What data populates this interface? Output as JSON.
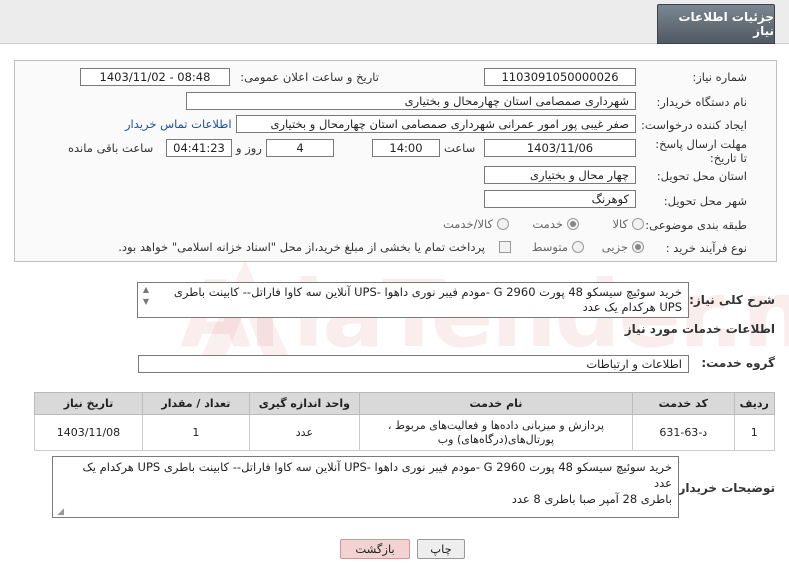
{
  "header": {
    "title": "جزئیات اطلاعات نیاز"
  },
  "form": {
    "need_number_label": "شماره نیاز:",
    "need_number": "1103091050000026",
    "announce_label": "تاریخ و ساعت اعلان عمومی:",
    "announce_value": "1403/11/02 - 08:48",
    "buyer_org_label": "نام دستگاه خریدار:",
    "buyer_org": "شهرداری صمصامی استان چهارمحال و بختیاری",
    "creator_label": "ایجاد کننده درخواست:",
    "creator": "صفر غیبی پور امور عمرانی شهرداری صمصامی استان چهارمحال و بختیاری",
    "contact_link": "اطلاعات تماس خریدار",
    "deadline_label": "مهلت ارسال پاسخ: تا تاریخ:",
    "deadline_date": "1403/11/06",
    "time_label": "ساعت",
    "deadline_time": "14:00",
    "days_value": "4",
    "days_label": "روز و",
    "remaining_time": "04:41:23",
    "remaining_label": "ساعت باقی مانده",
    "province_label": "استان محل تحویل:",
    "province": "چهار محال و بختیاری",
    "city_label": "شهر محل تحویل:",
    "city": "کوهرنگ",
    "category_label": "طبقه بندی موضوعی:",
    "category_options": [
      "کالا",
      "خدمت",
      "کالا/خدمت"
    ],
    "process_label": "نوع فرآیند خرید :",
    "process_options": [
      "جزیی",
      "متوسط"
    ],
    "payment_note": "پرداخت تمام یا بخشی از مبلغ خرید،از محل \"اسناد خزانه اسلامی\" خواهد بود."
  },
  "description": {
    "label": "شرح کلی نیاز:",
    "line1": "خرید سوئیچ سیسکو 48 پورت G 2960 -مودم فیبر نوری داهوا -UPS آنلاین سه کاوا فاراتل-- کابینت باطری",
    "line2": "UPS هرکدام یک عدد"
  },
  "services": {
    "section_title": "اطلاعات خدمات مورد نیاز",
    "group_label": "گروه خدمت:",
    "group_value": "اطلاعات و ارتباطات",
    "columns": [
      "ردیف",
      "کد خدمت",
      "نام خدمت",
      "واحد اندازه گیری",
      "تعداد / مقدار",
      "تاریخ نیاز"
    ],
    "rows": [
      {
        "row": "1",
        "code": "د-63-631",
        "name_line1": "پردازش و میزبانی داده‌ها و فعالیت‌های مربوط ،",
        "name_line2": "پورتال‌های(درگاه‌های) وب",
        "unit": "عدد",
        "qty": "1",
        "date": "1403/11/08"
      }
    ]
  },
  "buyer_notes": {
    "label": "توضیحات خریدار:",
    "line1": "خرید سوئیچ سیسکو 48 پورت G 2960 -مودم فیبر نوری داهوا -UPS آنلاین سه کاوا فاراتل-- کابینت باطری UPS هرکدام یک",
    "line2": "عدد",
    "line3": "باطری 28 آمپر صبا باطری 8 عدد"
  },
  "buttons": {
    "print": "چاپ",
    "back": "بازگشت"
  },
  "watermark": {
    "text": "AriaTender.neT"
  },
  "colors": {
    "header_tab": "#5f6a73",
    "link": "#1e4fa3",
    "back_button": "#f5d2d2",
    "watermark": "#c83c3c"
  }
}
